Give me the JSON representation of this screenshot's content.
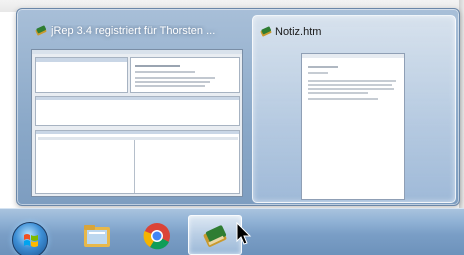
{
  "thumbnails": [
    {
      "title": "jRep 3.4 registriert für Thorsten ...",
      "icon": "book-icon"
    },
    {
      "title": "Notiz.htm",
      "icon": "book-icon"
    }
  ],
  "taskbar": {
    "start_icon": "windows-logo-icon",
    "buttons": [
      {
        "name": "explorer",
        "icon": "folder-icon"
      },
      {
        "name": "chrome",
        "icon": "chrome-icon"
      },
      {
        "name": "jrep",
        "icon": "book-icon",
        "active": true
      }
    ]
  },
  "colors": {
    "taskbar": "#7a9ec6",
    "flyout": "#8aa8c8",
    "active_highlight": "#ffffff"
  }
}
